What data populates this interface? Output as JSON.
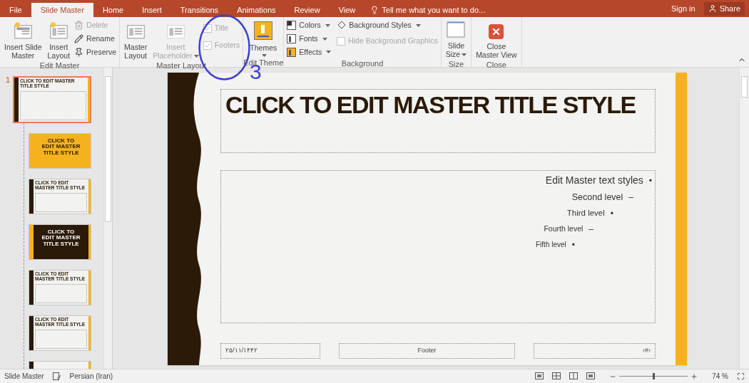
{
  "tabs": [
    {
      "label": "File",
      "selected": false
    },
    {
      "label": "Slide Master",
      "selected": true
    },
    {
      "label": "Home",
      "selected": false
    },
    {
      "label": "Insert",
      "selected": false
    },
    {
      "label": "Transitions",
      "selected": false
    },
    {
      "label": "Animations",
      "selected": false
    },
    {
      "label": "Review",
      "selected": false
    },
    {
      "label": "View",
      "selected": false
    }
  ],
  "tell_me": {
    "placeholder": "Tell me what you want to do..."
  },
  "account": {
    "sign_in": "Sign in",
    "share": "Share"
  },
  "ribbon": {
    "edit_master": {
      "label": "Edit Master",
      "large": [
        {
          "label": "Insert Slide",
          "label2": "Master",
          "kind": "slide-master"
        },
        {
          "label": "Insert",
          "label2": "Layout",
          "kind": "layout"
        }
      ],
      "small": [
        {
          "label": "Delete",
          "disabled": true,
          "kind": "delete"
        },
        {
          "label": "Rename",
          "disabled": false,
          "kind": "rename"
        },
        {
          "label": "Preserve",
          "disabled": false,
          "kind": "preserve"
        }
      ]
    },
    "master_layout": {
      "label": "Master Layout",
      "large": [
        {
          "label": "Master",
          "label2": "Layout",
          "disabled": false,
          "dropdown": false
        },
        {
          "label": "Insert",
          "label2": "Placeholder",
          "disabled": true,
          "dropdown": true
        }
      ],
      "checks": [
        {
          "label": "Title",
          "checked": true,
          "disabled": true
        },
        {
          "label": "Footers",
          "checked": true,
          "disabled": true
        }
      ]
    },
    "edit_theme": {
      "label": "Edit Theme",
      "button": {
        "label": "Themes",
        "dropdown": true
      }
    },
    "background": {
      "label": "Background",
      "items": [
        {
          "label": "Colors",
          "kind": "colors"
        },
        {
          "label": "Fonts",
          "kind": "fonts"
        },
        {
          "label": "Effects",
          "kind": "effects"
        }
      ],
      "styles": {
        "label": "Background Styles"
      },
      "hide": {
        "label": "Hide Background Graphics",
        "checked": false,
        "disabled": true
      }
    },
    "size": {
      "label": "Size",
      "button": {
        "label": "Slide",
        "label2": "Size"
      }
    },
    "close": {
      "label": "Close",
      "button": {
        "label": "Close",
        "label2": "Master View"
      }
    }
  },
  "annotation": {
    "label": "3"
  },
  "thumbnails": [
    {
      "number": "1",
      "kind": "master",
      "title": "CLICK TO EDIT MASTER TITLE STYLE",
      "selected": true
    },
    {
      "kind": "title",
      "title": "CLICK TO EDIT MASTER TITLE STYLE",
      "selected": false
    },
    {
      "kind": "content",
      "title": "CLICK TO EDIT MASTER TITLE STYLE",
      "selected": false
    },
    {
      "kind": "section",
      "title": "CLICK TO EDIT MASTER TITLE STYLE",
      "selected": false
    },
    {
      "kind": "two",
      "title": "CLICK TO EDIT MASTER TITLE STYLE",
      "selected": false
    },
    {
      "kind": "two",
      "title": "CLICK TO EDIT MASTER TITLE STYLE",
      "selected": false
    },
    {
      "kind": "partial",
      "selected": false
    }
  ],
  "slide": {
    "title": "CLICK TO EDIT MASTER TITLE STYLE",
    "levels": [
      {
        "text": "Edit Master text styles",
        "bullet": "•"
      },
      {
        "text": "Second level",
        "bullet": "–"
      },
      {
        "text": "Third level",
        "bullet": "•"
      },
      {
        "text": "Fourth level",
        "bullet": "–"
      },
      {
        "text": "Fifth level",
        "bullet": "•"
      }
    ],
    "date": "۲۵/۱۱/۱۴۴۲",
    "footer": "Footer",
    "number": "‹#›"
  },
  "status_bar": {
    "view": "Slide Master",
    "language": "Persian (Iran)",
    "zoom": "74 %",
    "zoom_slider": {
      "level": 0.5
    }
  }
}
